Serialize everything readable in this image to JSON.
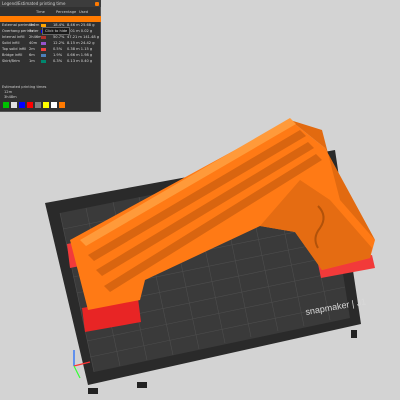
{
  "panel": {
    "header": "Legend/Estimated printing time",
    "columns": [
      "Time",
      "Percentage",
      "Used filament"
    ],
    "rows": [
      {
        "label": "",
        "time": "",
        "pct": "",
        "used": "",
        "color": "#ff7a00"
      },
      {
        "label": "External perimeter",
        "time": "1h1m",
        "pct": "18.4%",
        "used": "8.46 m 25.68 g",
        "color": "#ffa500"
      },
      {
        "label": "Overhang perimeter",
        "time": "7s",
        "pct": "0.0%",
        "used": "0.01 m 0.02 g",
        "color": "#0000ff"
      },
      {
        "label": "Internal infill",
        "time": "2h46m",
        "pct": "50.7%",
        "used": "47.21 m 141.48 g",
        "color": "#b03029"
      },
      {
        "label": "Solid infill",
        "time": "40m",
        "pct": "12.2%",
        "used": "8.15 m 24.42 g",
        "color": "#9654cc"
      },
      {
        "label": "Top solid infill",
        "time": "2m",
        "pct": "0.5%",
        "used": "0.38 m 1.15 g",
        "color": "#f04040"
      },
      {
        "label": "Bridge infill",
        "time": "6m",
        "pct": "1.9%",
        "used": "0.66 m 1.98 g",
        "color": "#4d80ba"
      },
      {
        "label": "Skirt/Brim",
        "time": "1m",
        "pct": "0.3%",
        "used": "0.13 m 0.40 g",
        "color": "#00876e"
      }
    ],
    "tooltip": "Click to hide",
    "footer_title": "Estimated printing times",
    "footer_lines": [
      "12m",
      "3h48m"
    ],
    "legend_colors": [
      "#00c000",
      "#e0e0e0",
      "#0000ff",
      "#ff0000",
      "#808080",
      "#ffff00",
      "#ffffff",
      "#ff7a00"
    ]
  },
  "brand": "snapmaker | J1"
}
